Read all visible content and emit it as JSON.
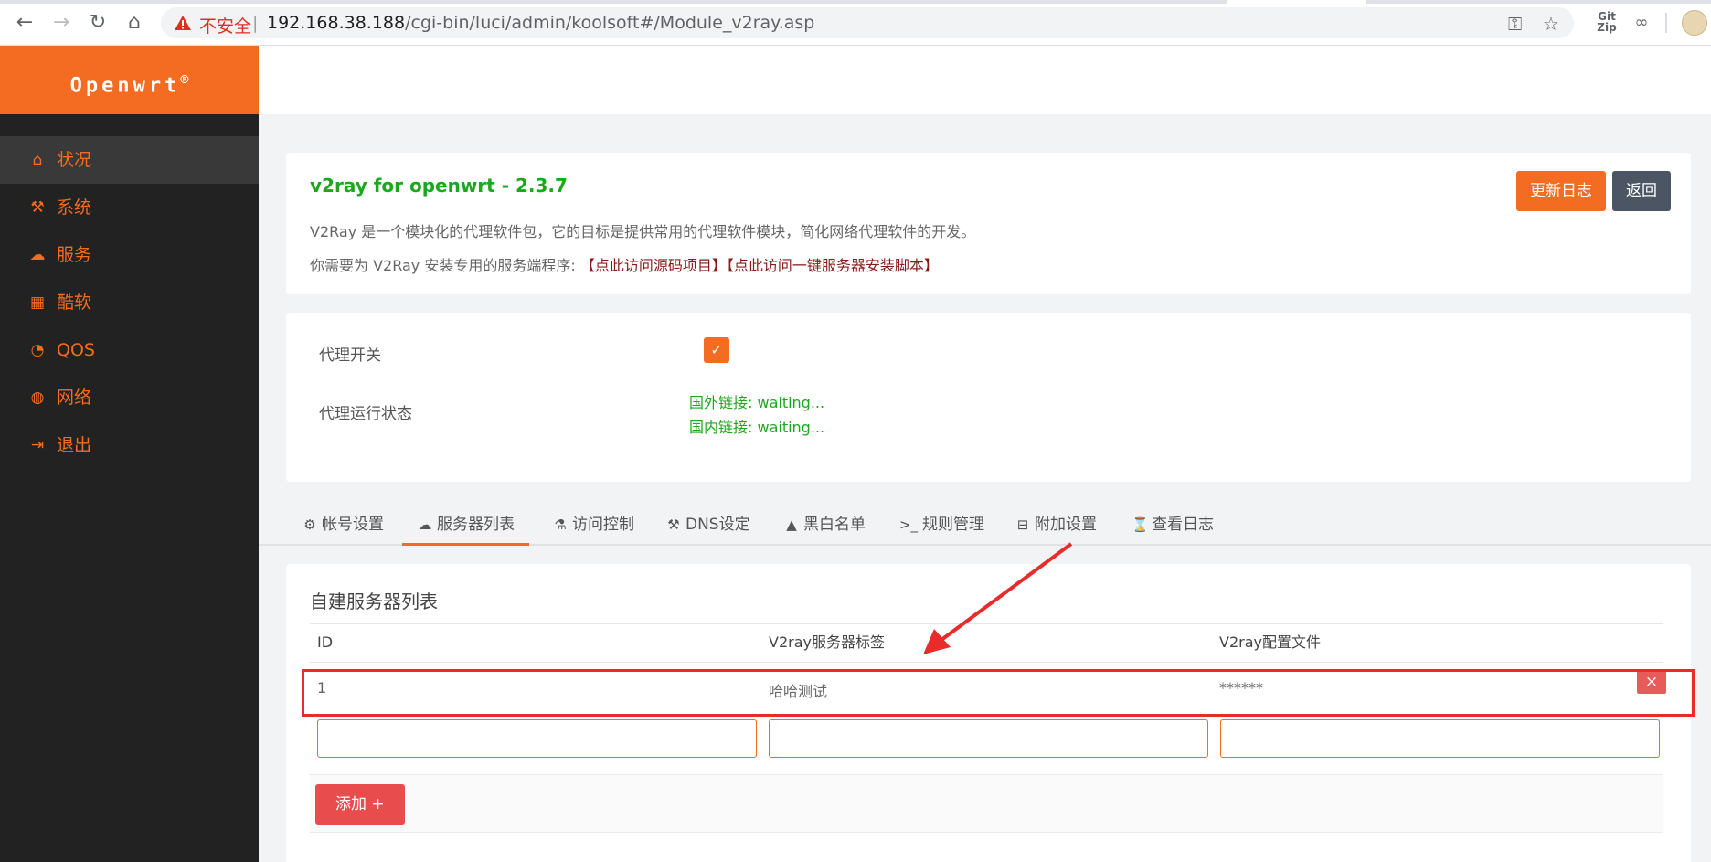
{
  "browser": {
    "insecure_label": "不安全",
    "url_host": "192.168.38.188",
    "url_path": "/cgi-bin/luci/admin/koolsoft#/Module_v2ray.asp",
    "ext_label": "Git Zip"
  },
  "brand": {
    "name": "Openwrt",
    "mark": "®"
  },
  "sidebar": {
    "items": [
      {
        "icon": "home-icon",
        "label": "状况"
      },
      {
        "icon": "tools-icon",
        "label": "系统"
      },
      {
        "icon": "cloud-icon",
        "label": "服务"
      },
      {
        "icon": "calendar-icon",
        "label": "酷软"
      },
      {
        "icon": "gauge-icon",
        "label": "QOS"
      },
      {
        "icon": "globe-icon",
        "label": "网络"
      },
      {
        "icon": "logout-icon",
        "label": "退出"
      }
    ]
  },
  "intro": {
    "title": "v2ray for openwrt - 2.3.7",
    "description": "V2Ray 是一个模块化的代理软件包，它的目标是提供常用的代理软件模块，简化网络代理软件的开发。",
    "links_prefix": "你需要为 V2Ray 安装专用的服务端程序: ",
    "link_source": "【点此访问源码项目】",
    "link_script": "【点此访问一键服务器安装脚本】",
    "changelog_button": "更新日志",
    "back_button": "返回"
  },
  "status": {
    "proxy_switch_label": "代理开关",
    "run_status_label": "代理运行状态",
    "foreign_status": "国外链接: waiting...",
    "domestic_status": "国内链接: waiting..."
  },
  "tabs": [
    {
      "icon": "gear-icon",
      "glyph": "⚙",
      "label": "帐号设置"
    },
    {
      "icon": "cloud-icon",
      "glyph": "☁",
      "label": "服务器列表"
    },
    {
      "icon": "lock-icon",
      "glyph": "🔒",
      "label": "访问控制"
    },
    {
      "icon": "tools-icon",
      "glyph": "⚒",
      "label": "DNS设定"
    },
    {
      "icon": "warning-icon",
      "glyph": "▲",
      "label": "黑白名单"
    },
    {
      "icon": "terminal-icon",
      "glyph": ">_",
      "label": "规则管理"
    },
    {
      "icon": "desktop-icon",
      "glyph": "⊟",
      "label": "附加设置"
    },
    {
      "icon": "hourglass-icon",
      "glyph": "⌛",
      "label": "查看日志"
    }
  ],
  "server_list": {
    "title": "自建服务器列表",
    "columns": [
      "ID",
      "V2ray服务器标签",
      "V2ray配置文件"
    ],
    "rows": [
      {
        "id": "1",
        "tag": "哈哈测试",
        "config": "******"
      }
    ],
    "delete_label": "×",
    "add_button": "添加 +"
  },
  "colors": {
    "accent": "#f36c21",
    "success": "#1ca81c",
    "danger": "#e84c4c",
    "sidebar_bg": "#222222",
    "annotation": "#e82b2b"
  }
}
